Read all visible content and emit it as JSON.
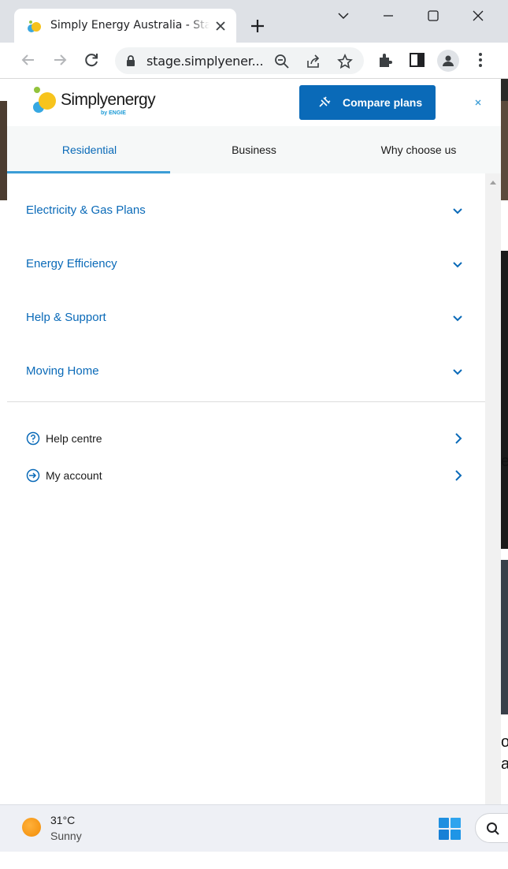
{
  "browser": {
    "tab_title": "Simply Energy Australia - Start",
    "url": "stage.simplyener..."
  },
  "site": {
    "logo_text": "Simplyenergy",
    "logo_byline": "by ENGIE",
    "compare_button": "Compare plans",
    "close_icon": "close-icon",
    "nav_tabs": [
      {
        "label": "Residential",
        "active": true
      },
      {
        "label": "Business",
        "active": false
      },
      {
        "label": "Why choose us",
        "active": false
      }
    ],
    "menu_items": [
      {
        "label": "Electricity & Gas Plans"
      },
      {
        "label": "Energy Efficiency"
      },
      {
        "label": "Help & Support"
      },
      {
        "label": "Moving Home"
      }
    ],
    "links": [
      {
        "label": "Help centre",
        "icon": "question-circle-icon"
      },
      {
        "label": "My account",
        "icon": "sign-in-icon"
      }
    ]
  },
  "taskbar": {
    "temperature": "31°C",
    "condition": "Sunny"
  },
  "colors": {
    "brand_blue": "#0a6ab8",
    "tab_underline": "#3b9dd6",
    "chrome_bg": "#dee1e6"
  }
}
